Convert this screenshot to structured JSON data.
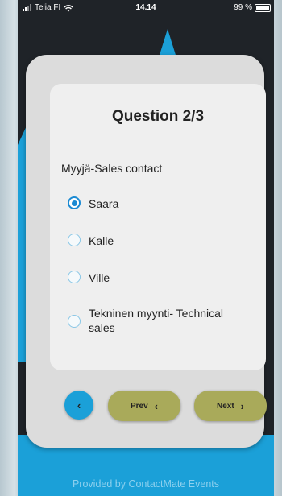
{
  "status_bar": {
    "carrier": "Telia FI",
    "time": "14.14",
    "battery": "99 %"
  },
  "quiz": {
    "title": "Question 2/3",
    "question": "Myyjä-Sales contact",
    "options": [
      {
        "label": "Saara",
        "selected": true
      },
      {
        "label": "Kalle",
        "selected": false
      },
      {
        "label": "Ville",
        "selected": false
      },
      {
        "label": "Tekninen myynti- Technical sales",
        "selected": false
      }
    ]
  },
  "nav": {
    "back_icon": "chevron-left-icon",
    "prev_label": "Prev",
    "prev_icon": "‹",
    "next_label": "Next",
    "next_icon": "›"
  },
  "footer": {
    "text": "Provided by ContactMate Events"
  },
  "colors": {
    "accent_blue": "#1ba0d8",
    "button_olive": "#a9aa5a",
    "radio_selected": "#1b8ad3"
  }
}
